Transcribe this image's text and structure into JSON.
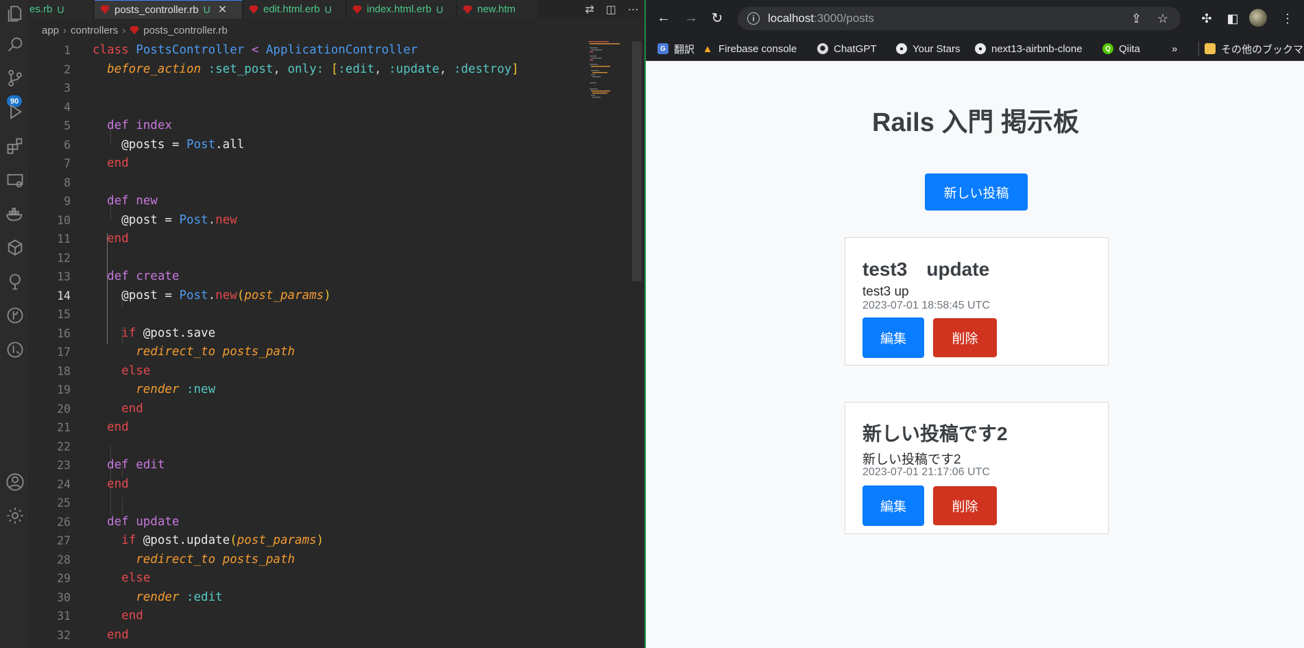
{
  "vscode": {
    "tabs": [
      {
        "label": "es.rb",
        "status": "U"
      },
      {
        "label": "posts_controller.rb",
        "status": "U"
      },
      {
        "label": "edit.html.erb",
        "status": "U"
      },
      {
        "label": "index.html.erb",
        "status": "U"
      },
      {
        "label": "new.htm",
        "status": ""
      }
    ],
    "breadcrumb": [
      "app",
      "controllers",
      "posts_controller.rb"
    ],
    "badge_count": "90",
    "current_line": 14,
    "line_numbers": [
      "1",
      "2",
      "3",
      "4",
      "5",
      "6",
      "7",
      "8",
      "9",
      "10",
      "11",
      "12",
      "13",
      "14",
      "15",
      "16",
      "17",
      "18",
      "19",
      "20",
      "21",
      "22",
      "23",
      "24",
      "25",
      "26",
      "27",
      "28",
      "29",
      "30",
      "31",
      "32"
    ],
    "code": {
      "l1": [
        "class",
        "PostsController",
        " < ",
        "ApplicationController"
      ],
      "l2": [
        "before_action",
        " :set_post",
        ", ",
        "only:",
        " [",
        ":edit",
        ", ",
        ":update",
        ", ",
        ":destroy",
        "]"
      ],
      "l5": [
        "def",
        " index"
      ],
      "l6": [
        "@posts = ",
        "Post",
        ".all"
      ],
      "l7": [
        "end"
      ],
      "l9": [
        "def",
        " new"
      ],
      "l10": [
        "@post = ",
        "Post",
        ".",
        "new"
      ],
      "l11": [
        "end"
      ],
      "l13": [
        "def",
        " create"
      ],
      "l14": [
        "@post = ",
        "Post",
        ".",
        "new",
        "(",
        "post_params",
        ")"
      ],
      "l16": [
        "if",
        " @post.save"
      ],
      "l17": [
        "redirect_to",
        " posts_path"
      ],
      "l18": [
        "else"
      ],
      "l19": [
        "render",
        " :new"
      ],
      "l20": [
        "end"
      ],
      "l21": [
        "end"
      ],
      "l23": [
        "def",
        " edit"
      ],
      "l24": [
        "end"
      ],
      "l26": [
        "def",
        " update"
      ],
      "l27": [
        "if",
        " @post.update",
        "(",
        "post_params",
        ")"
      ],
      "l28": [
        "redirect_to",
        " posts_path"
      ],
      "l29": [
        "else"
      ],
      "l30": [
        "render",
        " :edit"
      ],
      "l31": [
        "end"
      ],
      "l32": [
        "end"
      ]
    }
  },
  "browser": {
    "url_host": "localhost",
    "url_path": ":3000/posts",
    "bookmarks": [
      {
        "label": "翻訳",
        "icon": "google-translate-icon"
      },
      {
        "label": "Firebase console",
        "icon": "firebase-icon"
      },
      {
        "label": "ChatGPT",
        "icon": "chatgpt-icon"
      },
      {
        "label": "Your Stars",
        "icon": "github-icon"
      },
      {
        "label": "next13-airbnb-clone",
        "icon": "github-icon"
      },
      {
        "label": "Qiita",
        "icon": "qiita-icon"
      },
      {
        "label": "»",
        "icon": "more-icon"
      },
      {
        "label": "その他のブックマーク",
        "icon": "folder-icon"
      }
    ],
    "page": {
      "title": "Rails 入門 掲示板",
      "new_post_label": "新しい投稿",
      "posts": [
        {
          "title": "test3　update",
          "body": "test3 up",
          "time": "2023-07-01 18:58:45 UTC",
          "edit_label": "編集",
          "delete_label": "削除"
        },
        {
          "title": "新しい投稿です2",
          "body": "新しい投稿です2",
          "time": "2023-07-01 21:17:06 UTC",
          "edit_label": "編集",
          "delete_label": "削除"
        }
      ]
    }
  },
  "colors": {
    "primary": "#0a7cff",
    "danger": "#d0341f",
    "editor_bg": "#282828",
    "browser_toolbar": "#202124"
  }
}
